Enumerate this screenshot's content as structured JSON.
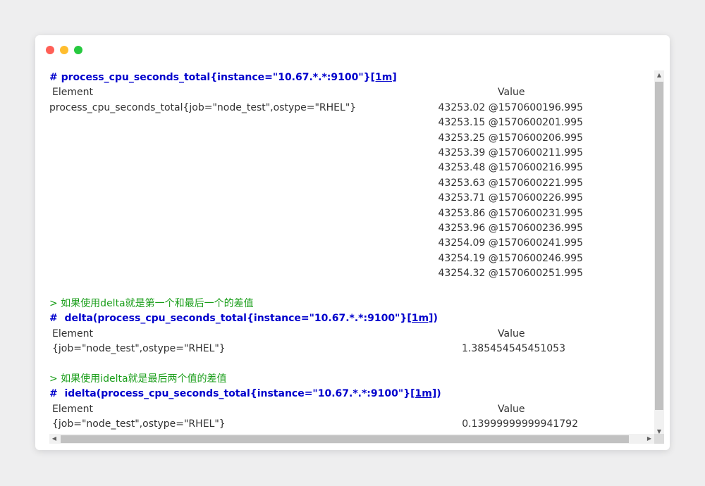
{
  "block1": {
    "command": "# process_cpu_seconds_total{instance=\"10.67.*.*:9100\"}",
    "range": "[1m]",
    "header_element": "Element",
    "header_value": "Value",
    "element": "process_cpu_seconds_total{job=\"node_test\",ostype=\"RHEL\"}",
    "values": [
      "43253.02 @1570600196.995",
      "43253.15 @1570600201.995",
      "43253.25 @1570600206.995",
      "43253.39 @1570600211.995",
      "43253.48 @1570600216.995",
      "43253.63 @1570600221.995",
      "43253.71 @1570600226.995",
      "43253.86 @1570600231.995",
      "43253.96 @1570600236.995",
      "43254.09 @1570600241.995",
      "43254.19 @1570600246.995",
      "43254.32 @1570600251.995"
    ]
  },
  "block2": {
    "comment": "> 如果使用delta就是第一个和最后一个的差值",
    "command_prefix": "#  delta(process_cpu_seconds_total{instance=\"10.67.*.*:9100\"}",
    "range": "[1m]",
    "command_suffix": ")",
    "header_element": "Element",
    "header_value": "Value",
    "element": "{job=\"node_test\",ostype=\"RHEL\"}",
    "value": "1.385454545451053"
  },
  "block3": {
    "comment": "> 如果使用idelta就是最后两个值的差值",
    "command_prefix": "#  idelta(process_cpu_seconds_total{instance=\"10.67.*.*:9100\"}",
    "range": "[1m]",
    "command_suffix": ")",
    "header_element": "Element",
    "header_value": "Value",
    "element": "{job=\"node_test\",ostype=\"RHEL\"}",
    "value": "0.13999999999941792"
  },
  "scrollbar": {
    "up_icon": "triangle-up",
    "down_icon": "triangle-down",
    "left_icon": "triangle-left",
    "right_icon": "triangle-right"
  }
}
